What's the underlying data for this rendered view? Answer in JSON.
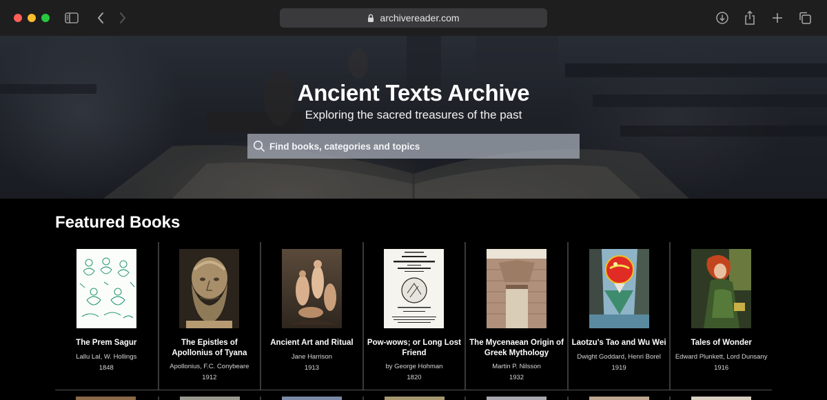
{
  "browser": {
    "url": "archivereader.com"
  },
  "hero": {
    "title": "Ancient Texts Archive",
    "subtitle": "Exploring the sacred treasures of the past",
    "search_placeholder": "Find books, categories and topics"
  },
  "featured": {
    "heading": "Featured Books",
    "books": [
      {
        "title": "The Prem Sagur",
        "author": "Lallu Lal, W. Hollings",
        "year": "1848"
      },
      {
        "title": "The Epistles of Apollonius of Tyana",
        "author": "Apollonius, F.C. Conybeare",
        "year": "1912"
      },
      {
        "title": "Ancient Art and Ritual",
        "author": "Jane Harrison",
        "year": "1913"
      },
      {
        "title": "Pow-wows; or Long Lost Friend",
        "author": "by George Hohman",
        "year": "1820"
      },
      {
        "title": "The Mycenaean Origin of Greek Mythology",
        "author": "Martin P. Nilsson",
        "year": "1932"
      },
      {
        "title": "Laotzu's Tao and Wu Wei",
        "author": "Dwight Goddard, Henri Borel",
        "year": "1919"
      },
      {
        "title": "Tales of Wonder",
        "author": "Edward Plunkett, Lord Dunsany",
        "year": "1916"
      }
    ]
  },
  "colors": {
    "chrome_bg": "#1e1e1e",
    "address_bar_bg": "#3a3a3c",
    "page_bg": "#000000",
    "divider": "#3a3a3a"
  },
  "icons": {
    "sidebar": "sidebar-icon",
    "back": "chevron-left-icon",
    "forward": "chevron-right-icon",
    "lock": "lock-icon",
    "download": "download-icon",
    "share": "share-icon",
    "new_tab": "plus-icon",
    "tabs": "tabs-overview-icon",
    "search": "search-icon"
  }
}
